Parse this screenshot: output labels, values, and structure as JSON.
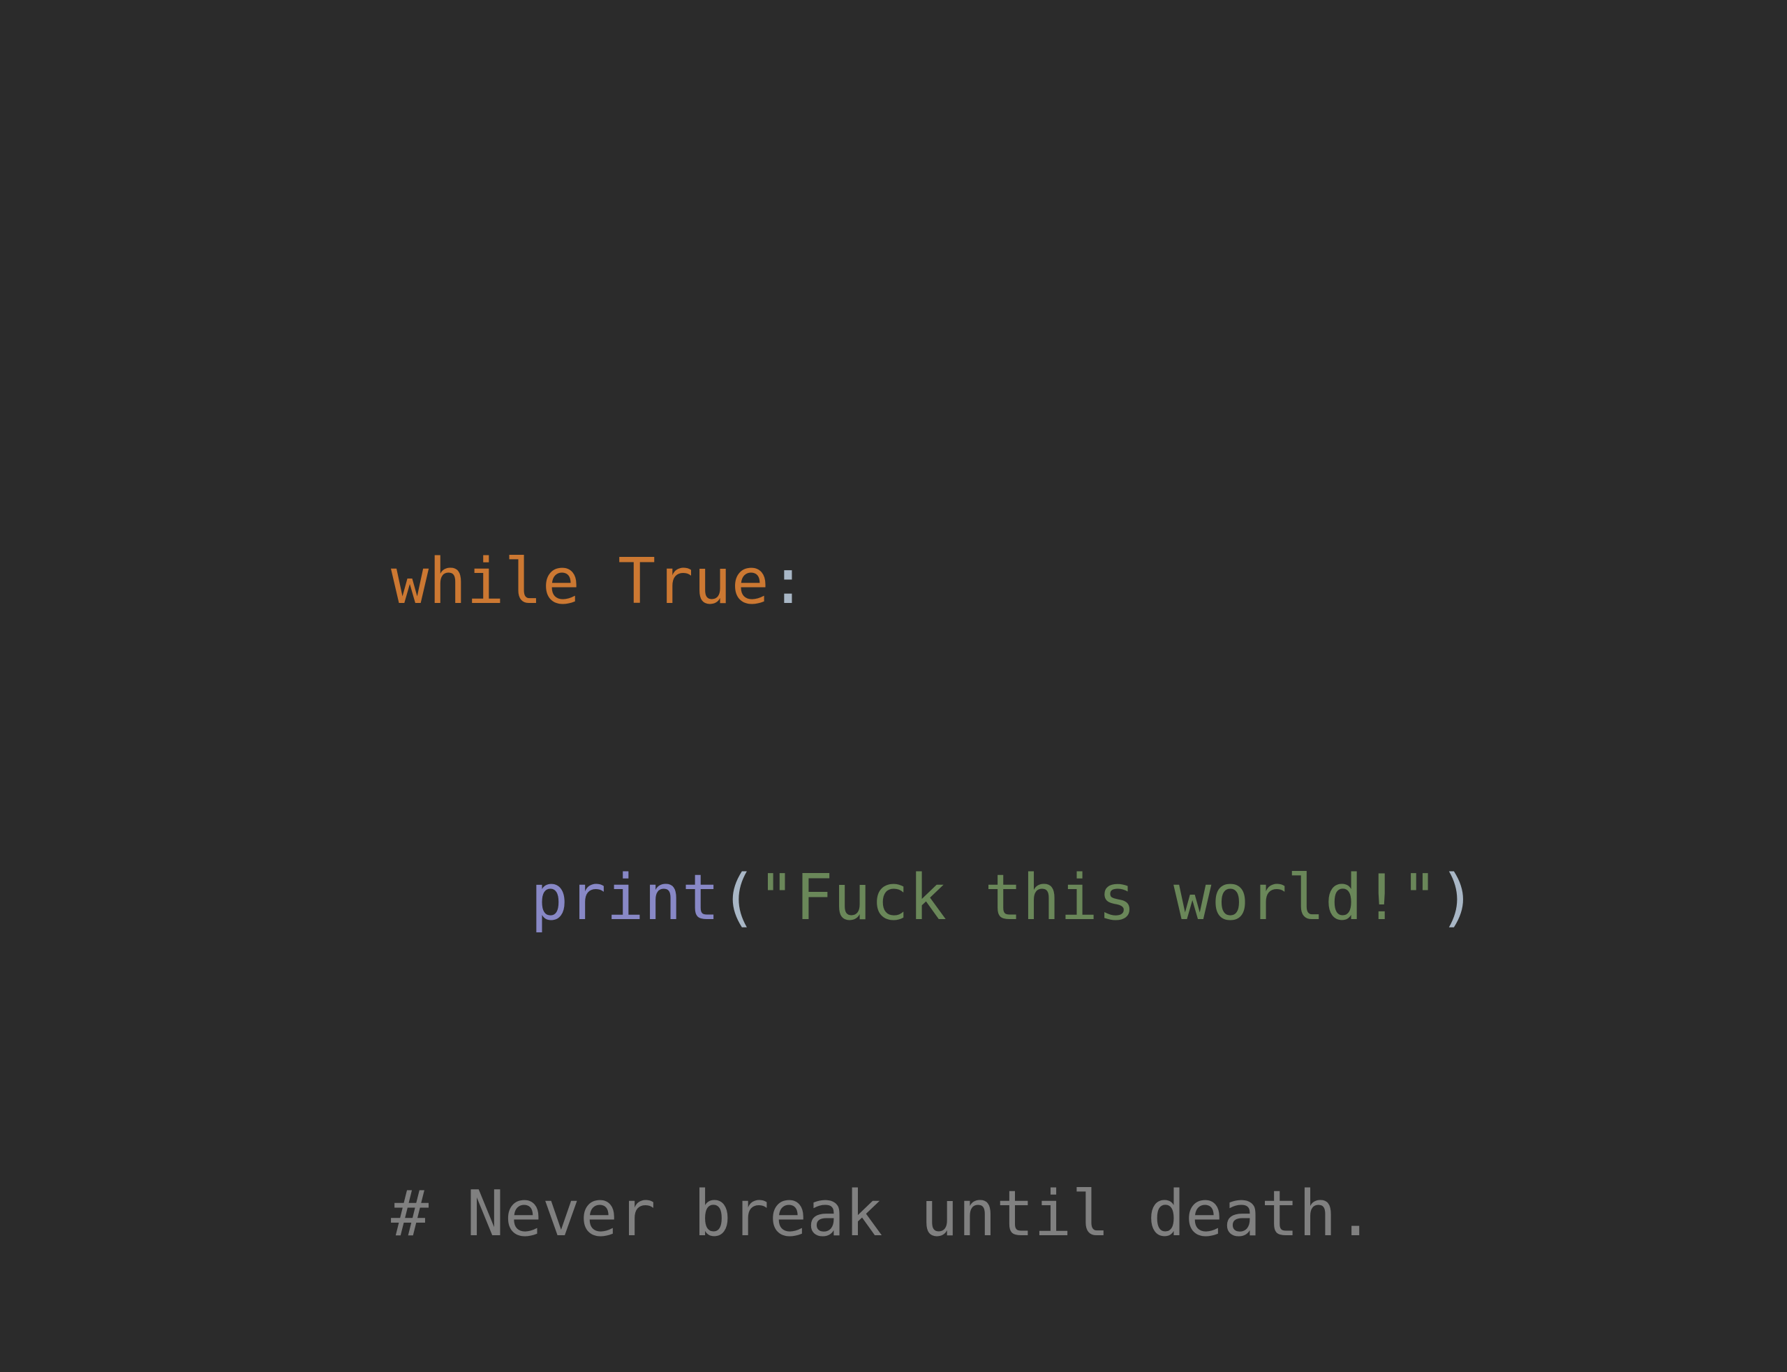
{
  "code": {
    "line1": {
      "keyword_while": "while",
      "space": " ",
      "keyword_true": "True",
      "colon": ":"
    },
    "line2": {
      "builtin_print": "print",
      "open_paren": "(",
      "string": "\"Fuck this world!\"",
      "close_paren": ")"
    },
    "line3": {
      "comment": "# Never break until death."
    }
  },
  "colors": {
    "background": "#2b2b2b",
    "keyword": "#cc7832",
    "punctuation": "#a9b7c6",
    "builtin": "#8888c6",
    "string": "#6a8759",
    "comment": "#808080"
  }
}
